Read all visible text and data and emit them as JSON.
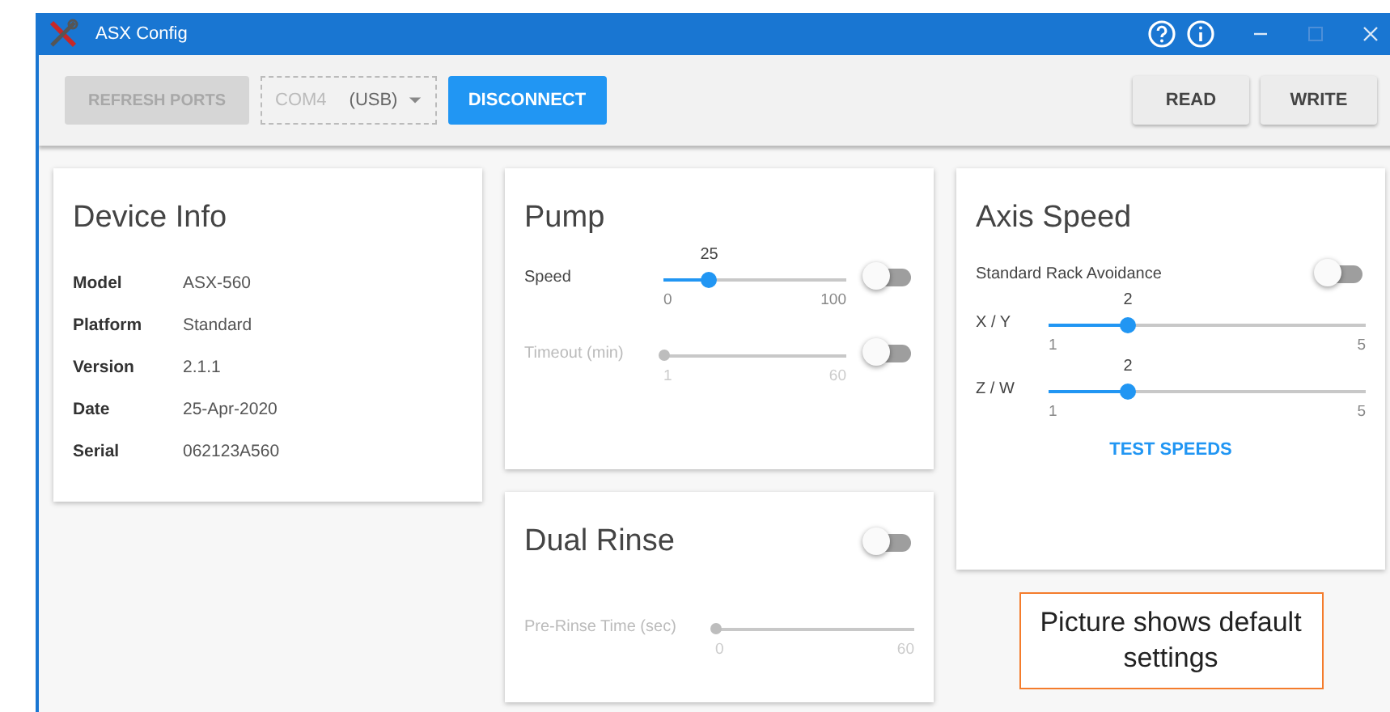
{
  "window": {
    "title": "ASX Config"
  },
  "toolbar": {
    "refresh": {
      "label": "REFRESH PORTS",
      "disabled": true
    },
    "port": {
      "value": "COM4",
      "detail": "(USB)",
      "disabled": true
    },
    "connect": {
      "label": "DISCONNECT"
    },
    "read": {
      "label": "READ"
    },
    "write": {
      "label": "WRITE"
    }
  },
  "device_info": {
    "title": "Device Info",
    "rows": [
      {
        "label": "Model",
        "value": "ASX-560"
      },
      {
        "label": "Platform",
        "value": "Standard"
      },
      {
        "label": "Version",
        "value": "2.1.1"
      },
      {
        "label": "Date",
        "value": "25-Apr-2020"
      },
      {
        "label": "Serial",
        "value": "062123A560"
      }
    ]
  },
  "pump": {
    "title": "Pump",
    "controls": [
      {
        "label": "Speed",
        "value": "25",
        "min": "0",
        "max": "100",
        "level": 0.25,
        "disabled": false,
        "on": false
      },
      {
        "label": "Timeout (min)",
        "min": "1",
        "max": "60",
        "level": 0,
        "disabled": true,
        "on": false
      }
    ]
  },
  "dual_rinse": {
    "title": "Dual Rinse",
    "on": false,
    "slider": {
      "label": "Pre-Rinse Time (sec)",
      "min": "0",
      "max": "60",
      "level": 0,
      "disabled": true
    }
  },
  "axis_speed": {
    "title": "Axis Speed",
    "avoidance": {
      "label": "Standard Rack Avoidance",
      "on": false
    },
    "sliders": [
      {
        "label": "X / Y",
        "value": "2",
        "min": "1",
        "max": "5",
        "level": 0.25,
        "disabled": false
      },
      {
        "label": "Z / W",
        "value": "2",
        "min": "1",
        "max": "5",
        "level": 0.25,
        "disabled": false
      }
    ],
    "button": "TEST SPEEDS"
  },
  "note": "Picture shows default settings"
}
